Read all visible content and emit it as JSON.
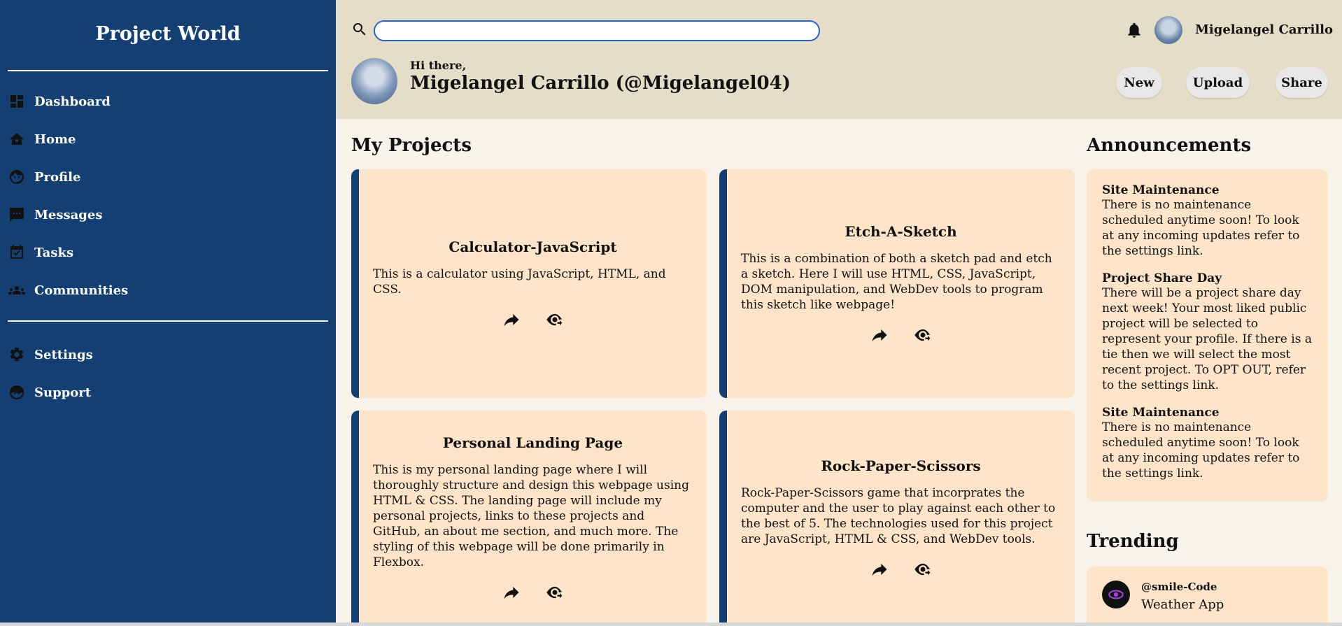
{
  "app": {
    "title": "Project World"
  },
  "sidebar": {
    "items": [
      {
        "label": "Dashboard",
        "icon": "dashboard-icon"
      },
      {
        "label": "Home",
        "icon": "home-icon"
      },
      {
        "label": "Profile",
        "icon": "profile-icon"
      },
      {
        "label": "Messages",
        "icon": "messages-icon"
      },
      {
        "label": "Tasks",
        "icon": "tasks-icon"
      },
      {
        "label": "Communities",
        "icon": "communities-icon"
      }
    ],
    "secondary": [
      {
        "label": "Settings",
        "icon": "gear-icon"
      },
      {
        "label": "Support",
        "icon": "support-icon"
      }
    ]
  },
  "header": {
    "search": {
      "value": "",
      "placeholder": ""
    },
    "user_name": "Migelangel Carrillo",
    "greeting": "Hi there,",
    "full_name": "Migelangel Carrillo (@Migelangel04)",
    "buttons": {
      "new": "New",
      "upload": "Upload",
      "share": "Share"
    }
  },
  "main": {
    "projects_title": "My Projects",
    "projects": [
      {
        "title": "Calculator-JavaScript",
        "description": "This is a calculator using JavaScript, HTML, and CSS."
      },
      {
        "title": "Etch-A-Sketch",
        "description": "This is a combination of both a sketch pad and etch a sketch. Here I will use HTML, CSS, JavaScript, DOM manipulation, and WebDev tools to program this sketch like webpage!"
      },
      {
        "title": "Personal Landing Page",
        "description": "This is my personal landing page where I will thoroughly structure and design this webpage using HTML & CSS. The landing page will include my personal projects, links to these projects and GitHub, an about me section, and much more. The styling of this webpage will be done primarily in Flexbox."
      },
      {
        "title": "Rock-Paper-Scissors",
        "description": "Rock-Paper-Scissors game that incorprates the computer and the user to play against each other to the best of 5. The technologies used for this project are JavaScript, HTML & CSS, and WebDev tools."
      }
    ]
  },
  "announcements": {
    "title": "Announcements",
    "items": [
      {
        "title": "Site Maintenance",
        "body": "There is no maintenance scheduled anytime soon! To look at any incoming updates refer to the settings link."
      },
      {
        "title": "Project Share Day",
        "body": "There will be a project share day next week! Your most liked public project will be selected to represent your profile. If there is a tie then we will select the most recent project. To OPT OUT, refer to the settings link."
      },
      {
        "title": "Site Maintenance",
        "body": "There is no maintenance scheduled anytime soon! To look at any incoming updates refer to the settings link."
      }
    ]
  },
  "trending": {
    "title": "Trending",
    "items": [
      {
        "user": "@smile-Code",
        "project": "Weather App"
      }
    ]
  },
  "colors": {
    "sidebar": "#133f73",
    "header": "#e4ddc7",
    "card": "#fee4c9",
    "background": "#f7f3ea"
  }
}
